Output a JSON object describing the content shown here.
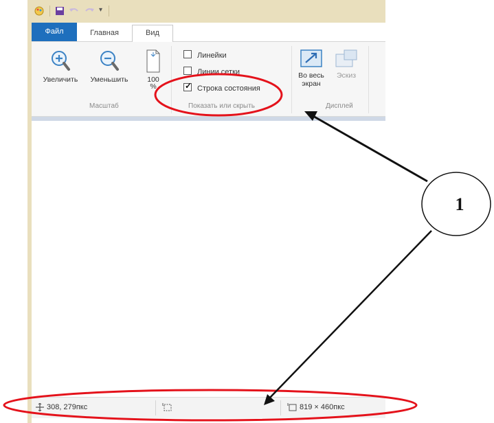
{
  "ribbon": {
    "tabs": {
      "file": "Файл",
      "home": "Главная",
      "view": "Вид"
    },
    "zoom_in_label": "Увеличить",
    "zoom_out_label": "Уменьшить",
    "zoom_100_label_line1": "100",
    "zoom_100_label_line2": "%",
    "zoom_group_label": "Масштаб",
    "rulers_label": "Линейки",
    "gridlines_label": "Линии сетки",
    "statusbar_label": "Строка состояния",
    "rulers_checked": false,
    "gridlines_checked": false,
    "statusbar_checked": true,
    "show_hide_group_label": "Показать или скрыть",
    "fullscreen_label_line1": "Во весь",
    "fullscreen_label_line2": "экран",
    "thumbnail_label": "Эскиз",
    "display_group_label": "Дисплей"
  },
  "status_bar": {
    "cursor_position": "308, 279пкс",
    "selection_size": "",
    "image_size": "819 × 460пкс"
  },
  "annotation": {
    "callout_number": "1",
    "highlight_color": "#e4121b"
  }
}
